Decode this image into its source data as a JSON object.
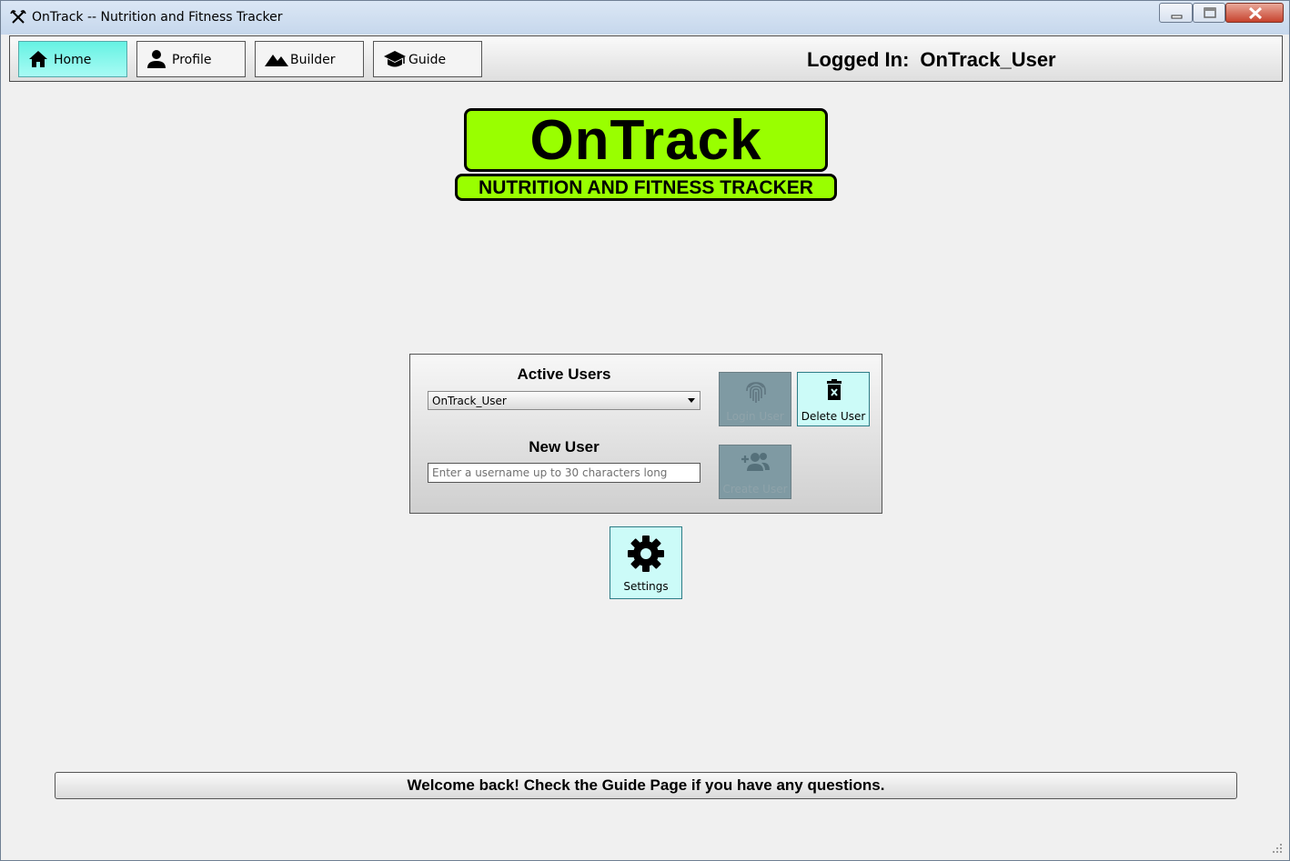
{
  "window": {
    "title": "OnTrack -- Nutrition and Fitness Tracker",
    "app_icon": "fork-knife-icon",
    "controls": [
      "minimize-icon",
      "maximize-icon",
      "close-icon"
    ]
  },
  "nav": {
    "tabs": [
      {
        "label": "Home",
        "icon": "home-icon",
        "active": true
      },
      {
        "label": "Profile",
        "icon": "person-icon",
        "active": false
      },
      {
        "label": "Builder",
        "icon": "mountains-icon",
        "active": false
      },
      {
        "label": "Guide",
        "icon": "graduation-cap-icon",
        "active": false
      }
    ],
    "logged_in_label": "Logged In:",
    "logged_in_user": "OnTrack_User"
  },
  "logo": {
    "title": "OnTrack",
    "subtitle": "NUTRITION AND FITNESS TRACKER"
  },
  "users_panel": {
    "active_users_heading": "Active Users",
    "active_user_selected": "OnTrack_User",
    "new_user_heading": "New User",
    "new_user_value": "",
    "new_user_placeholder": "Enter a username up to 30 characters long",
    "login_button": {
      "label": "Login User",
      "icon": "fingerprint-icon",
      "enabled": false
    },
    "delete_button": {
      "label": "Delete User",
      "icon": "trash-icon",
      "enabled": true
    },
    "create_button": {
      "label": "Create User",
      "icon": "add-user-icon",
      "enabled": false
    }
  },
  "settings_button": {
    "label": "Settings",
    "icon": "gear-icon"
  },
  "status_message": "Welcome back! Check the Guide Page if you have any questions.",
  "colors": {
    "logo_green": "#99ff00",
    "active_tab": "#66f2e3",
    "enabled_button": "#ccfbf8",
    "disabled_button": "#7f9aa3"
  }
}
